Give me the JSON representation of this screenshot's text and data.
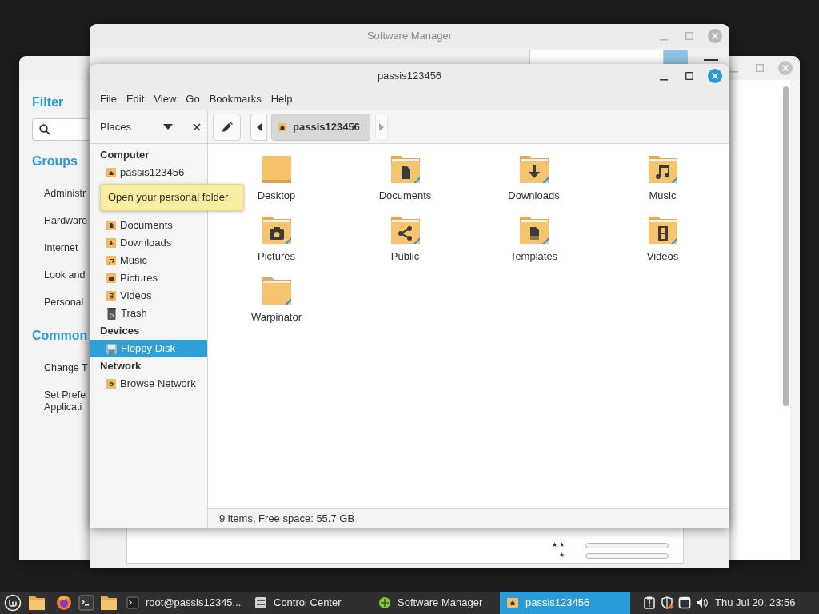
{
  "control_center": {
    "filter_heading": "Filter",
    "groups_heading": "Groups",
    "groups": [
      {
        "lines": [
          "Administr"
        ]
      },
      {
        "lines": [
          "Hardware"
        ]
      },
      {
        "lines": [
          "Internet"
        ]
      },
      {
        "lines": [
          "Look and"
        ]
      },
      {
        "lines": [
          "Personal"
        ]
      }
    ],
    "common_heading": "Common",
    "common": [
      {
        "lines": [
          "Change T"
        ]
      },
      {
        "lines": [
          "Set Prefe",
          "Applicati"
        ]
      }
    ]
  },
  "software_manager": {
    "title": "Software Manager",
    "ratings": [
      {
        "label": "★ ★"
      },
      {
        "label": "★"
      }
    ]
  },
  "file_manager": {
    "title": "passis123456",
    "menu": [
      "File",
      "Edit",
      "View",
      "Go",
      "Bookmarks",
      "Help"
    ],
    "sidebar_label": "Places",
    "location": "passis123456",
    "sections": [
      {
        "heading": "Computer",
        "items": [
          {
            "label": "passis123456",
            "kind": "home",
            "selected": false
          },
          {
            "kind": "tooltip",
            "label": "Open your personal folder"
          },
          {
            "label": "Documents",
            "kind": "document",
            "selected": false
          },
          {
            "label": "Downloads",
            "kind": "download",
            "selected": false
          },
          {
            "label": "Music",
            "kind": "music",
            "selected": false
          },
          {
            "label": "Pictures",
            "kind": "camera",
            "selected": false
          },
          {
            "label": "Videos",
            "kind": "film",
            "selected": false
          },
          {
            "label": "Trash",
            "kind": "trash",
            "selected": false
          }
        ]
      },
      {
        "heading": "Devices",
        "items": [
          {
            "label": "Floppy Disk",
            "kind": "floppy",
            "selected": true
          }
        ]
      },
      {
        "heading": "Network",
        "items": [
          {
            "label": "Browse Network",
            "kind": "network",
            "selected": false
          }
        ]
      }
    ],
    "files": [
      {
        "name": "Desktop",
        "kind": "desktop"
      },
      {
        "name": "Documents",
        "kind": "document"
      },
      {
        "name": "Downloads",
        "kind": "download"
      },
      {
        "name": "Music",
        "kind": "music"
      },
      {
        "name": "Pictures",
        "kind": "camera"
      },
      {
        "name": "Public",
        "kind": "share"
      },
      {
        "name": "Templates",
        "kind": "template"
      },
      {
        "name": "Videos",
        "kind": "film"
      },
      {
        "name": "Warpinator",
        "kind": "plain"
      }
    ],
    "status": "9 items, Free space: 55.7 GB"
  },
  "taskbar": {
    "tasks": [
      {
        "label": "root@passis12345...",
        "kind": "terminal",
        "selected": false
      },
      {
        "label": "Control Center",
        "kind": "control",
        "selected": false
      },
      {
        "label": "Software Manager",
        "kind": "software",
        "selected": false
      },
      {
        "label": "passis123456",
        "kind": "folder",
        "selected": true
      }
    ],
    "clock": "Thu Jul 20, 23:56"
  }
}
